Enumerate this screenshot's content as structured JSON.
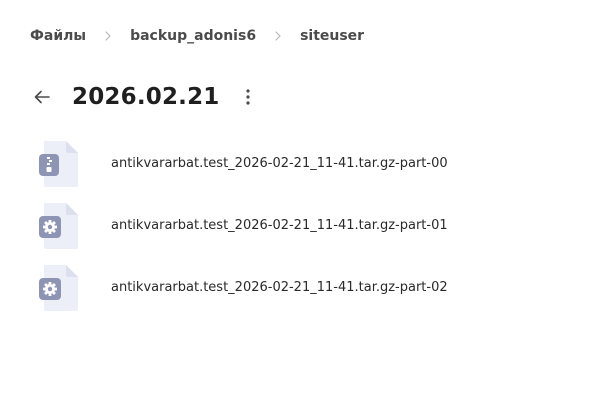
{
  "breadcrumb": {
    "items": [
      {
        "label": "Файлы"
      },
      {
        "label": "backup_adonis6"
      },
      {
        "label": "siteuser"
      }
    ]
  },
  "header": {
    "back_icon": "arrow-left-icon",
    "title": "2026.02.21",
    "more_icon": "vertical-dots-icon"
  },
  "files": [
    {
      "name": "antikvararbat.test_2026-02-21_11-41.tar.gz-part-00",
      "icon": "archive-file-icon"
    },
    {
      "name": "antikvararbat.test_2026-02-21_11-41.tar.gz-part-01",
      "icon": "settings-file-icon"
    },
    {
      "name": "antikvararbat.test_2026-02-21_11-41.tar.gz-part-02",
      "icon": "settings-file-icon"
    }
  ],
  "colors": {
    "file_body": "#eceef8",
    "file_fold": "#dcdfee",
    "badge": "#8e94b4",
    "text": "#1f1f1f"
  }
}
